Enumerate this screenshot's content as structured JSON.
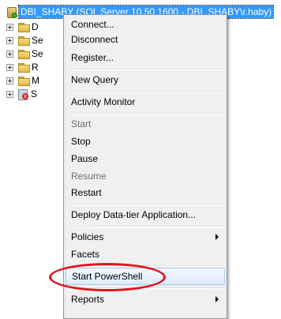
{
  "tree": {
    "root_label": "DBI_SHABY (SQL Server 10.50.1600 - DBI_SHABY\\r.haby)",
    "nodes": [
      {
        "label": "D",
        "icon": "folder-icon"
      },
      {
        "label": "Se",
        "icon": "folder-icon"
      },
      {
        "label": "Se",
        "icon": "folder-icon"
      },
      {
        "label": "R",
        "icon": "folder-icon"
      },
      {
        "label": "M",
        "icon": "folder-icon"
      },
      {
        "label": "S",
        "icon": "sql-agent-stopped-icon"
      }
    ]
  },
  "menu": {
    "items": {
      "connect": "Connect...",
      "disconnect": "Disconnect",
      "register": "Register...",
      "new_query": "New Query",
      "activity_monitor": "Activity Monitor",
      "start": "Start",
      "stop": "Stop",
      "pause": "Pause",
      "resume": "Resume",
      "restart": "Restart",
      "deploy": "Deploy Data-tier Application...",
      "policies": "Policies",
      "facets": "Facets",
      "start_powershell": "Start PowerShell",
      "reports": "Reports"
    }
  },
  "colors": {
    "selection": "#3399ff",
    "annotation": "#e0151b",
    "menu_background": "#f0f0f0"
  }
}
